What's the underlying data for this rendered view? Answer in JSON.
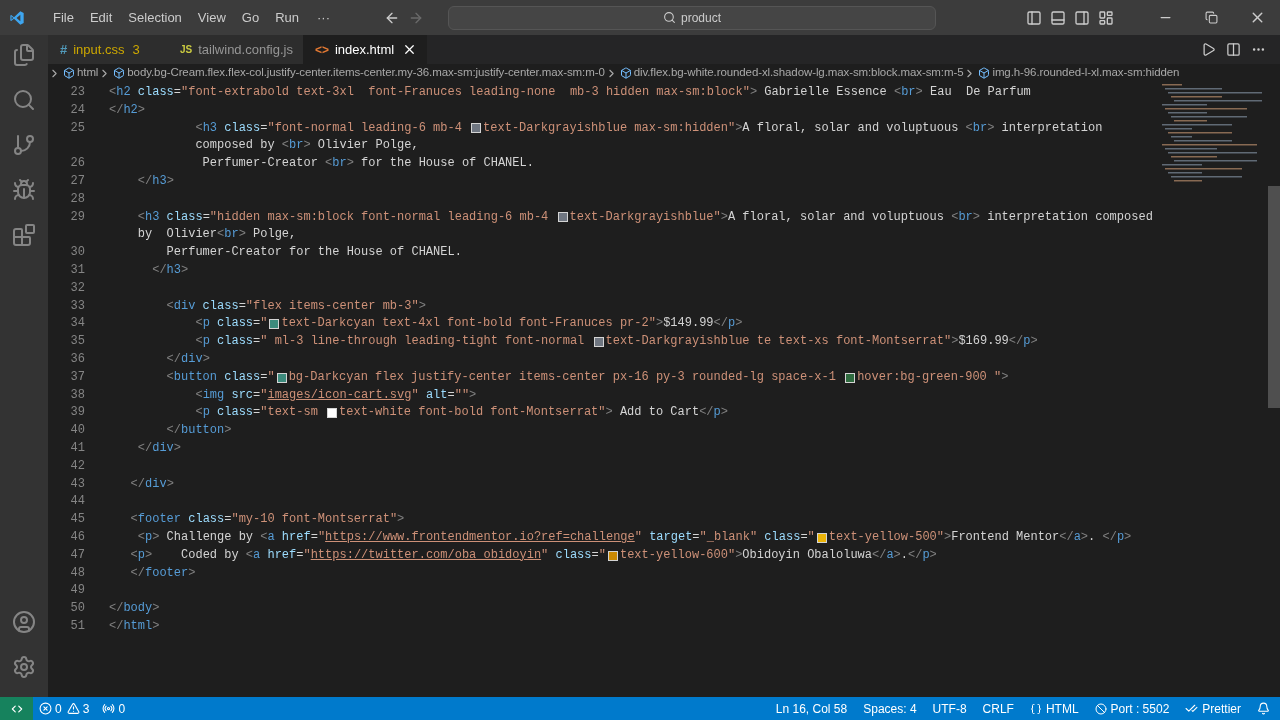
{
  "menu": [
    "File",
    "Edit",
    "Selection",
    "View",
    "Go",
    "Run"
  ],
  "overflow": "···",
  "nav": {
    "back_disabled": false,
    "forward_disabled": true
  },
  "search": {
    "value": "product"
  },
  "tabs": [
    {
      "label": "input.css",
      "kind": "css",
      "icon": "#",
      "badge": "3",
      "selected": false
    },
    {
      "label": "tailwind.config.js",
      "kind": "js",
      "icon": "JS",
      "selected": false
    },
    {
      "label": "index.html",
      "kind": "html",
      "icon": "<>",
      "selected": true
    }
  ],
  "breadcrumb": [
    "html",
    "body.bg-Cream.flex.flex-col.justify-center.items-center.my-36.max-sm:justify-center.max-sm:m-0",
    "div.flex.bg-white.rounded-xl.shadow-lg.max-sm:block.max-sm:m-5",
    "img.h-96.rounded-l-xl.max-sm:hidden"
  ],
  "editor": {
    "lines": [
      {
        "number": "23",
        "tokens": [
          {
            "kind": "bracket",
            "text": "<"
          },
          {
            "kind": "tag",
            "text": "h2"
          },
          {
            "kind": "attr",
            "text": " class"
          },
          {
            "kind": "text",
            "text": "="
          },
          {
            "kind": "string",
            "text": "\"font-extrabold text-3xl  font-Franuces leading-none  mb-3 hidden max-sm:block\""
          },
          {
            "kind": "bracket",
            "text": ">"
          },
          {
            "kind": "text",
            "text": " Gabrielle Essence "
          },
          {
            "kind": "bracket",
            "text": "<"
          },
          {
            "kind": "tag",
            "text": "br"
          },
          {
            "kind": "bracket",
            "text": ">"
          },
          {
            "kind": "text",
            "text": " Eau  De Parfum"
          }
        ]
      },
      {
        "number": "24",
        "tokens": [
          {
            "kind": "bracket",
            "text": "</"
          },
          {
            "kind": "tag",
            "text": "h2"
          },
          {
            "kind": "bracket",
            "text": ">"
          }
        ]
      },
      {
        "number": "25",
        "tokens": [
          {
            "kind": "bracket",
            "text": "            <"
          },
          {
            "kind": "tag",
            "text": "h3"
          },
          {
            "kind": "attr",
            "text": " class"
          },
          {
            "kind": "text",
            "text": "="
          },
          {
            "kind": "string",
            "text": "\"font-normal leading-6 mb-4 "
          },
          {
            "kind": "swatch",
            "color": "#6f7681"
          },
          {
            "kind": "string",
            "text": "text-Darkgrayishblue max-sm:hidden\""
          },
          {
            "kind": "bracket",
            "text": ">"
          },
          {
            "kind": "text",
            "text": "A floral, solar and voluptuous "
          },
          {
            "kind": "bracket",
            "text": "<"
          },
          {
            "kind": "tag",
            "text": "br"
          },
          {
            "kind": "bracket",
            "text": ">"
          },
          {
            "kind": "text",
            "text": " interpretation"
          }
        ]
      },
      {
        "tokens": [
          {
            "kind": "text",
            "text": "            composed by "
          },
          {
            "kind": "bracket",
            "text": "<"
          },
          {
            "kind": "tag",
            "text": "br"
          },
          {
            "kind": "bracket",
            "text": ">"
          },
          {
            "kind": "text",
            "text": " Olivier Polge,"
          }
        ]
      },
      {
        "number": "26",
        "tokens": [
          {
            "kind": "text",
            "text": "             Perfumer-Creator "
          },
          {
            "kind": "bracket",
            "text": "<"
          },
          {
            "kind": "tag",
            "text": "br"
          },
          {
            "kind": "bracket",
            "text": ">"
          },
          {
            "kind": "text",
            "text": " for the House of CHANEL."
          }
        ]
      },
      {
        "number": "27",
        "tokens": [
          {
            "kind": "bracket",
            "text": "    </"
          },
          {
            "kind": "tag",
            "text": "h3"
          },
          {
            "kind": "bracket",
            "text": ">"
          }
        ]
      },
      {
        "number": "28"
      },
      {
        "number": "29",
        "tokens": [
          {
            "kind": "bracket",
            "text": "    <"
          },
          {
            "kind": "tag",
            "text": "h3"
          },
          {
            "kind": "attr",
            "text": " class"
          },
          {
            "kind": "text",
            "text": "="
          },
          {
            "kind": "string",
            "text": "\"hidden max-sm:block font-normal leading-6 mb-4 "
          },
          {
            "kind": "swatch",
            "color": "#6f7681"
          },
          {
            "kind": "string",
            "text": "text-Darkgrayishblue\""
          },
          {
            "kind": "bracket",
            "text": ">"
          },
          {
            "kind": "text",
            "text": "A floral, solar and voluptuous "
          },
          {
            "kind": "bracket",
            "text": "<"
          },
          {
            "kind": "tag",
            "text": "br"
          },
          {
            "kind": "bracket",
            "text": ">"
          },
          {
            "kind": "text",
            "text": " interpretation composed"
          }
        ]
      },
      {
        "tokens": [
          {
            "kind": "text",
            "text": "    by  Olivier"
          },
          {
            "kind": "bracket",
            "text": "<"
          },
          {
            "kind": "tag",
            "text": "br"
          },
          {
            "kind": "bracket",
            "text": ">"
          },
          {
            "kind": "text",
            "text": " Polge,"
          }
        ]
      },
      {
        "number": "30",
        "tokens": [
          {
            "kind": "text",
            "text": "        Perfumer-Creator for the House of CHANEL."
          }
        ]
      },
      {
        "number": "31",
        "tokens": [
          {
            "kind": "bracket",
            "text": "      </"
          },
          {
            "kind": "tag",
            "text": "h3"
          },
          {
            "kind": "bracket",
            "text": ">"
          }
        ]
      },
      {
        "number": "32"
      },
      {
        "number": "33",
        "tokens": [
          {
            "kind": "bracket",
            "text": "        <"
          },
          {
            "kind": "tag",
            "text": "div"
          },
          {
            "kind": "attr",
            "text": " class"
          },
          {
            "kind": "text",
            "text": "="
          },
          {
            "kind": "string",
            "text": "\"flex items-center mb-3\""
          },
          {
            "kind": "bracket",
            "text": ">"
          }
        ]
      },
      {
        "number": "34",
        "tokens": [
          {
            "kind": "bracket",
            "text": "            <"
          },
          {
            "kind": "tag",
            "text": "p"
          },
          {
            "kind": "attr",
            "text": " class"
          },
          {
            "kind": "text",
            "text": "="
          },
          {
            "kind": "string",
            "text": "\""
          },
          {
            "kind": "swatch",
            "color": "#3d8b7d"
          },
          {
            "kind": "string",
            "text": "text-Darkcyan text-4xl font-bold font-Franuces pr-2\""
          },
          {
            "kind": "bracket",
            "text": ">"
          },
          {
            "kind": "text",
            "text": "$149.99"
          },
          {
            "kind": "bracket",
            "text": "</"
          },
          {
            "kind": "tag",
            "text": "p"
          },
          {
            "kind": "bracket",
            "text": ">"
          }
        ]
      },
      {
        "number": "35",
        "tokens": [
          {
            "kind": "bracket",
            "text": "            <"
          },
          {
            "kind": "tag",
            "text": "p"
          },
          {
            "kind": "attr",
            "text": " class"
          },
          {
            "kind": "text",
            "text": "="
          },
          {
            "kind": "string",
            "text": "\" ml-3 line-through leading-tight font-normal "
          },
          {
            "kind": "swatch",
            "color": "#6f7681"
          },
          {
            "kind": "string",
            "text": "text-Darkgrayishblue te text-xs font-Montserrat\""
          },
          {
            "kind": "bracket",
            "text": ">"
          },
          {
            "kind": "text",
            "text": "$169.99"
          },
          {
            "kind": "bracket",
            "text": "</"
          },
          {
            "kind": "tag",
            "text": "p"
          },
          {
            "kind": "bracket",
            "text": ">"
          }
        ]
      },
      {
        "number": "36",
        "tokens": [
          {
            "kind": "bracket",
            "text": "        </"
          },
          {
            "kind": "tag",
            "text": "div"
          },
          {
            "kind": "bracket",
            "text": ">"
          }
        ]
      },
      {
        "number": "37",
        "tokens": [
          {
            "kind": "bracket",
            "text": "        <"
          },
          {
            "kind": "tag",
            "text": "button"
          },
          {
            "kind": "attr",
            "text": " class"
          },
          {
            "kind": "text",
            "text": "="
          },
          {
            "kind": "string",
            "text": "\""
          },
          {
            "kind": "swatch",
            "color": "#3d8b7d"
          },
          {
            "kind": "string",
            "text": "bg-Darkcyan flex justify-center items-center px-16 py-3 rounded-lg space-x-1 "
          },
          {
            "kind": "swatch",
            "color": "#2f6b3f"
          },
          {
            "kind": "string",
            "text": "hover:bg-green-900 \""
          },
          {
            "kind": "bracket",
            "text": ">"
          }
        ]
      },
      {
        "number": "38",
        "tokens": [
          {
            "kind": "bracket",
            "text": "            <"
          },
          {
            "kind": "tag",
            "text": "img"
          },
          {
            "kind": "attr",
            "text": " src"
          },
          {
            "kind": "text",
            "text": "="
          },
          {
            "kind": "string",
            "text": "\""
          },
          {
            "kind": "url",
            "text": "images/icon-cart.svg"
          },
          {
            "kind": "string",
            "text": "\""
          },
          {
            "kind": "attr",
            "text": " alt"
          },
          {
            "kind": "text",
            "text": "="
          },
          {
            "kind": "string",
            "text": "\"\""
          },
          {
            "kind": "bracket",
            "text": ">"
          }
        ]
      },
      {
        "number": "39",
        "tokens": [
          {
            "kind": "bracket",
            "text": "            <"
          },
          {
            "kind": "tag",
            "text": "p"
          },
          {
            "kind": "attr",
            "text": " class"
          },
          {
            "kind": "text",
            "text": "="
          },
          {
            "kind": "string",
            "text": "\"text-sm "
          },
          {
            "kind": "swatch",
            "color": "#ffffff"
          },
          {
            "kind": "string",
            "text": "text-white font-bold font-Montserrat\""
          },
          {
            "kind": "bracket",
            "text": ">"
          },
          {
            "kind": "text",
            "text": " Add to Cart"
          },
          {
            "kind": "bracket",
            "text": "</"
          },
          {
            "kind": "tag",
            "text": "p"
          },
          {
            "kind": "bracket",
            "text": ">"
          }
        ]
      },
      {
        "number": "40",
        "tokens": [
          {
            "kind": "bracket",
            "text": "        </"
          },
          {
            "kind": "tag",
            "text": "button"
          },
          {
            "kind": "bracket",
            "text": ">"
          }
        ]
      },
      {
        "number": "41",
        "tokens": [
          {
            "kind": "bracket",
            "text": "    </"
          },
          {
            "kind": "tag",
            "text": "div"
          },
          {
            "kind": "bracket",
            "text": ">"
          }
        ]
      },
      {
        "number": "42"
      },
      {
        "number": "43",
        "tokens": [
          {
            "kind": "bracket",
            "text": "   </"
          },
          {
            "kind": "tag",
            "text": "div"
          },
          {
            "kind": "bracket",
            "text": ">"
          }
        ]
      },
      {
        "number": "44"
      },
      {
        "number": "45",
        "tokens": [
          {
            "kind": "bracket",
            "text": "   <"
          },
          {
            "kind": "tag",
            "text": "footer"
          },
          {
            "kind": "attr",
            "text": " class"
          },
          {
            "kind": "text",
            "text": "="
          },
          {
            "kind": "string",
            "text": "\"my-10 font-Montserrat\""
          },
          {
            "kind": "bracket",
            "text": ">"
          }
        ]
      },
      {
        "number": "46",
        "tokens": [
          {
            "kind": "bracket",
            "text": "    <"
          },
          {
            "kind": "tag",
            "text": "p"
          },
          {
            "kind": "bracket",
            "text": ">"
          },
          {
            "kind": "text",
            "text": " Challenge by "
          },
          {
            "kind": "bracket",
            "text": "<"
          },
          {
            "kind": "tag",
            "text": "a"
          },
          {
            "kind": "attr",
            "text": " href"
          },
          {
            "kind": "text",
            "text": "="
          },
          {
            "kind": "string",
            "text": "\""
          },
          {
            "kind": "url",
            "text": "https://www.frontendmentor.io?ref=challenge"
          },
          {
            "kind": "string",
            "text": "\""
          },
          {
            "kind": "attr",
            "text": " target"
          },
          {
            "kind": "text",
            "text": "="
          },
          {
            "kind": "string",
            "text": "\"_blank\""
          },
          {
            "kind": "attr",
            "text": " class"
          },
          {
            "kind": "text",
            "text": "="
          },
          {
            "kind": "string",
            "text": "\""
          },
          {
            "kind": "swatch",
            "color": "#eab308"
          },
          {
            "kind": "string",
            "text": "text-yellow-500\""
          },
          {
            "kind": "bracket",
            "text": ">"
          },
          {
            "kind": "text",
            "text": "Frontend Mentor"
          },
          {
            "kind": "bracket",
            "text": "</"
          },
          {
            "kind": "tag",
            "text": "a"
          },
          {
            "kind": "bracket",
            "text": ">"
          },
          {
            "kind": "text",
            "text": ". "
          },
          {
            "kind": "bracket",
            "text": "</"
          },
          {
            "kind": "tag",
            "text": "p"
          },
          {
            "kind": "bracket",
            "text": ">"
          }
        ]
      },
      {
        "number": "47",
        "tokens": [
          {
            "kind": "bracket",
            "text": "   <"
          },
          {
            "kind": "tag",
            "text": "p"
          },
          {
            "kind": "bracket",
            "text": ">"
          },
          {
            "kind": "text",
            "text": "    Coded by "
          },
          {
            "kind": "bracket",
            "text": "<"
          },
          {
            "kind": "tag",
            "text": "a"
          },
          {
            "kind": "attr",
            "text": " href"
          },
          {
            "kind": "text",
            "text": "="
          },
          {
            "kind": "string",
            "text": "\""
          },
          {
            "kind": "url",
            "text": "https://twitter.com/oba_obidoyin"
          },
          {
            "kind": "string",
            "text": "\""
          },
          {
            "kind": "attr",
            "text": " class"
          },
          {
            "kind": "text",
            "text": "="
          },
          {
            "kind": "string",
            "text": "\""
          },
          {
            "kind": "swatch",
            "color": "#ca8a04"
          },
          {
            "kind": "string",
            "text": "text-yellow-600\""
          },
          {
            "kind": "bracket",
            "text": ">"
          },
          {
            "kind": "text",
            "text": "Obidoyin Obaloluwa"
          },
          {
            "kind": "bracket",
            "text": "</"
          },
          {
            "kind": "tag",
            "text": "a"
          },
          {
            "kind": "bracket",
            "text": ">"
          },
          {
            "kind": "text",
            "text": "."
          },
          {
            "kind": "bracket",
            "text": "</"
          },
          {
            "kind": "tag",
            "text": "p"
          },
          {
            "kind": "bracket",
            "text": ">"
          }
        ]
      },
      {
        "number": "48",
        "tokens": [
          {
            "kind": "bracket",
            "text": "   </"
          },
          {
            "kind": "tag",
            "text": "footer"
          },
          {
            "kind": "bracket",
            "text": ">"
          }
        ]
      },
      {
        "number": "49"
      },
      {
        "number": "50",
        "tokens": [
          {
            "kind": "bracket",
            "text": "</"
          },
          {
            "kind": "tag",
            "text": "body"
          },
          {
            "kind": "bracket",
            "text": ">"
          }
        ]
      },
      {
        "number": "51",
        "tokens": [
          {
            "kind": "bracket",
            "text": "</"
          },
          {
            "kind": "tag",
            "text": "html"
          },
          {
            "kind": "bracket",
            "text": ">"
          }
        ]
      }
    ]
  },
  "status_bar": {
    "errors": "0",
    "warnings": "3",
    "ports": "0",
    "items": [
      {
        "kind": "text",
        "text": "Ln 16, Col 58"
      },
      {
        "kind": "text",
        "text": "Spaces: 4"
      },
      {
        "kind": "text",
        "text": "UTF-8"
      },
      {
        "kind": "text",
        "text": "CRLF"
      },
      {
        "kind": "language",
        "text": "HTML"
      },
      {
        "kind": "port",
        "text": "Port : 5502"
      },
      {
        "kind": "formatter",
        "text": "Prettier"
      }
    ]
  }
}
